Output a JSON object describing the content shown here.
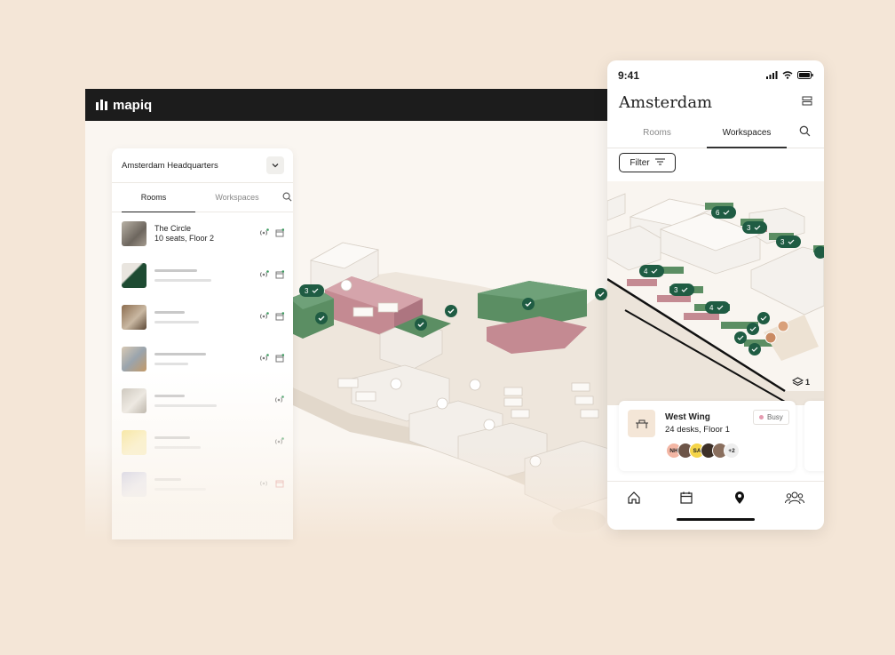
{
  "brand": {
    "name": "mapiq"
  },
  "desktop_panel": {
    "building": "Amsterdam Headquarters",
    "tabs": [
      "Rooms",
      "Workspaces"
    ],
    "active_tab": "Rooms",
    "rooms": [
      {
        "name": "The Circle",
        "details": "10 seats, Floor 2"
      }
    ]
  },
  "phone": {
    "time": "9:41",
    "city": "Amsterdam",
    "tabs": [
      "Rooms",
      "Workspaces"
    ],
    "active_tab": "Workspaces",
    "filter_label": "Filter",
    "floor_indicator": "1",
    "map_badges": [
      "6",
      "3",
      "3",
      "4",
      "3",
      "4"
    ],
    "card": {
      "name": "West Wing",
      "details": "24 desks, Floor 1",
      "status": "Busy",
      "avatars": [
        "NH",
        "SA"
      ],
      "more": "+2"
    },
    "nav": [
      "home-icon",
      "calendar-icon",
      "map-pin-icon",
      "people-icon"
    ]
  },
  "desktop_map": {
    "badges": [
      "3"
    ]
  },
  "colors": {
    "background": "#f4e6d7",
    "accent_green": "#1f5c43",
    "room_green": "#5b8e63",
    "room_pink": "#c48a92",
    "topbar": "#1c1c1c"
  }
}
